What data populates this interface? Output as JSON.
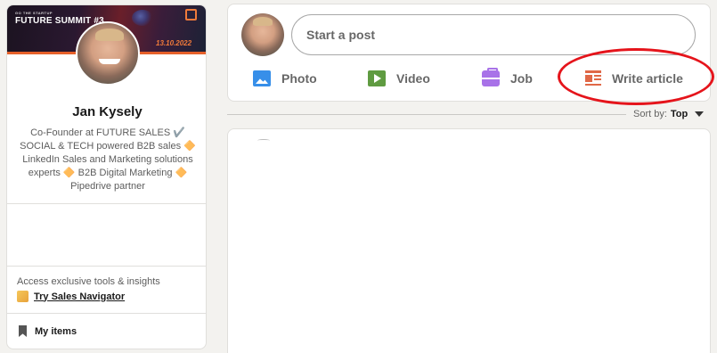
{
  "profile": {
    "banner_small": "GO THE STARTUP",
    "banner_title": "FUTURE SUMMIT #3",
    "banner_date": "13.10.2022",
    "name": "Jan Kysely",
    "headline": "Co-Founder at FUTURE SALES ✔️ SOCIAL & TECH powered B2B sales 🔶 LinkedIn Sales and Marketing solutions experts 🔶 B2B Digital Marketing 🔶 Pipedrive partner",
    "promo_text": "Access exclusive tools & insights",
    "promo_link": "Try Sales Navigator",
    "my_items": "My items"
  },
  "share_box": {
    "placeholder": "Start a post",
    "actions": [
      {
        "label": "Photo",
        "icon": "photo-icon"
      },
      {
        "label": "Video",
        "icon": "video-icon"
      },
      {
        "label": "Job",
        "icon": "job-icon"
      },
      {
        "label": "Write article",
        "icon": "article-icon"
      }
    ]
  },
  "sort": {
    "label": "Sort by:",
    "value": "Top"
  },
  "colors": {
    "background": "#f3f2ef",
    "photo": "#378fe9",
    "video": "#5f9b41",
    "job": "#a872e8",
    "article": "#e06847",
    "highlight": "#e5141b"
  }
}
